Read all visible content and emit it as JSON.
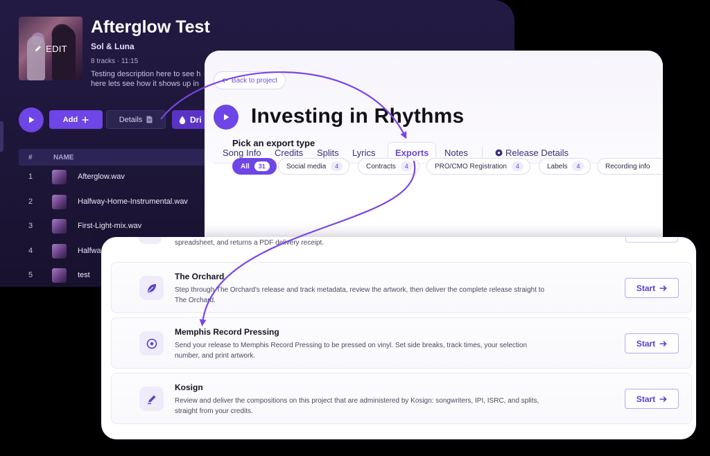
{
  "album": {
    "edit_label": "EDIT",
    "title": "Afterglow Test",
    "artist": "Sol & Luna",
    "meta": "8 tracks  ·  11:15",
    "description_line1": "Testing description here to see h",
    "description_line2": "here lets see how it shows up in",
    "add_label": "Add",
    "details_label": "Details",
    "drip_label": "Dri",
    "col_num": "#",
    "col_name": "NAME",
    "tracks": [
      {
        "num": "1",
        "name": "Afterglow.wav"
      },
      {
        "num": "2",
        "name": "Halfway-Home-Instrumental.wav"
      },
      {
        "num": "3",
        "name": "First-Light-mix.wav"
      },
      {
        "num": "4",
        "name": "Halfwa"
      },
      {
        "num": "5",
        "name": "test"
      }
    ]
  },
  "project": {
    "back_label": "Back to project",
    "title": "Investing in Rhythms",
    "tabs": [
      "Song Info",
      "Credits",
      "Splits",
      "Lyrics",
      "Exports",
      "Notes"
    ],
    "active_tab": "Exports",
    "release_details_label": "Release Details",
    "pick_title": "Pick an export type",
    "chips": [
      {
        "label": "All",
        "count": "31"
      },
      {
        "label": "Social media",
        "count": "4"
      },
      {
        "label": "Contracts",
        "count": "4"
      },
      {
        "label": "PRO/CMO Registration",
        "count": "4"
      },
      {
        "label": "Labels",
        "count": "4"
      },
      {
        "label": "Recording info",
        "count": ""
      }
    ]
  },
  "exports": {
    "partial_text": "spreadsheet, and returns a PDF delivery receipt.",
    "start_label": "Start",
    "items": [
      {
        "title": "The Orchard",
        "desc": "Step through The Orchard's release and track metadata, review the artwork, then deliver the complete release straight to The Orchard.",
        "icon": "leaf-icon"
      },
      {
        "title": "Memphis Record Pressing",
        "desc": "Send your release to Memphis Record Pressing to be pressed on vinyl. Set side breaks, track times, your selection number, and print artwork.",
        "icon": "vinyl-icon"
      },
      {
        "title": "Kosign",
        "desc": "Review and deliver the compositions on this project that are administered by Kosign: songwriters, IPI, ISRC, and splits, straight from your credits.",
        "icon": "pen-icon"
      }
    ]
  },
  "colors": {
    "accent": "#6e45e6",
    "dark_panel": "#1d1638",
    "text_dark": "#121018"
  }
}
